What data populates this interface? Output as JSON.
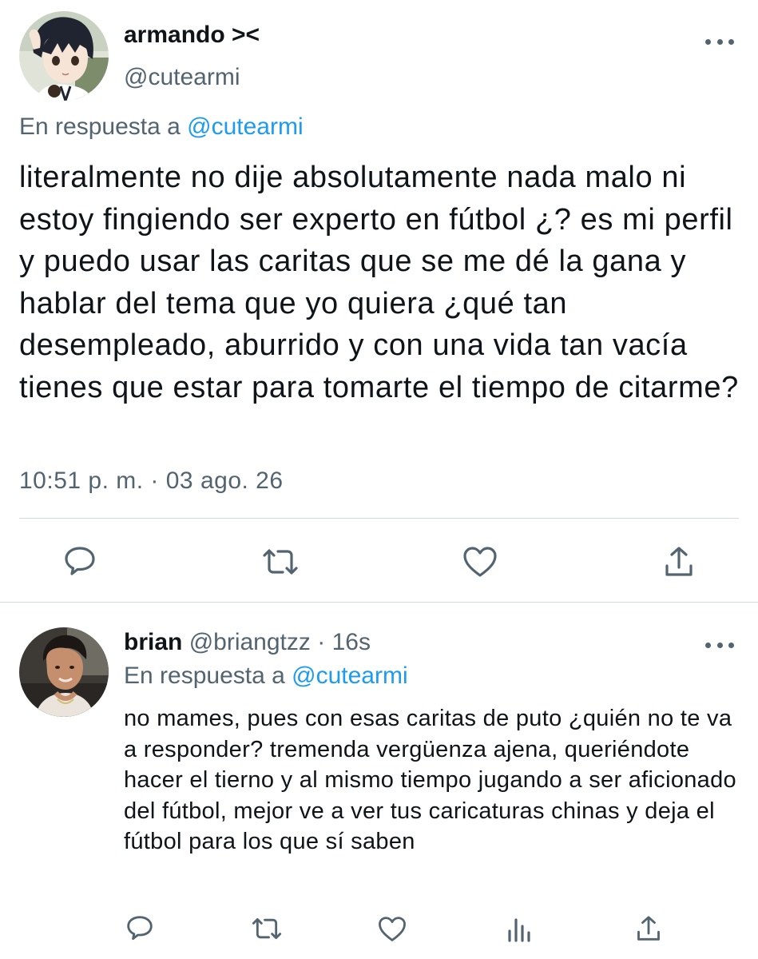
{
  "main_tweet": {
    "display_name": "armando ><",
    "handle": "@cutearmi",
    "reply_to_prefix": "En respuesta a",
    "reply_to_handle": "@cutearmi",
    "text": "literalmente no dije absolutamente nada malo ni estoy fingiendo ser experto en fútbol ¿? es mi perfil y puedo usar las caritas que se me dé la gana y hablar del tema que yo quiera ¿qué tan desempleado, aburrido y con una vida tan vacía tienes que estar para tomarte el tiempo de citarme?",
    "timestamp": "10:51 p. m. · 03 ago. 26",
    "actions": [
      "reply-icon",
      "retweet-icon",
      "like-icon",
      "share-icon"
    ]
  },
  "reply_tweet": {
    "display_name": "brian",
    "handle": "@briangtzz",
    "separator": "·",
    "age": "16s",
    "reply_to_prefix": "En respuesta a",
    "reply_to_handle": "@cutearmi",
    "text": "no mames, pues con esas caritas de puto ¿quién no te va a responder?  tremenda vergüenza ajena, queriéndote hacer el tierno y al mismo tiempo jugando a ser aficionado del fútbol, mejor ve a ver tus caricaturas chinas y deja el fútbol para los que sí saben",
    "actions": [
      "reply-icon",
      "retweet-icon",
      "like-icon",
      "analytics-icon",
      "share-icon"
    ]
  },
  "colors": {
    "text_primary": "#0f1419",
    "text_secondary": "#536471",
    "accent": "#1d9bf0",
    "divider": "#cfd9de"
  }
}
